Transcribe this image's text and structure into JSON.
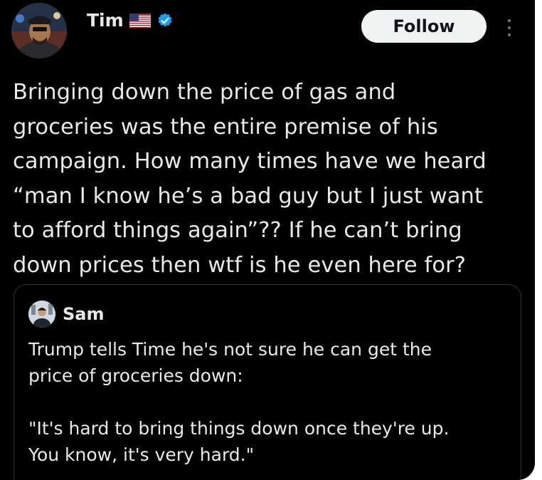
{
  "author": {
    "name": "Tim",
    "flag_icon": "us-flag-icon",
    "verified_icon": "verified-badge-icon",
    "verified_color": "#1d9bf0"
  },
  "actions": {
    "follow_label": "Follow",
    "more_icon": "more-vertical-icon"
  },
  "tweet": {
    "text": "Bringing down the price of gas and\ngroceries was the entire premise of his\ncampaign. How many times have we heard\n“man I know he’s a bad guy but I just want\nto afford things again”?? If he can’t bring\ndown prices then wtf is he even here for?"
  },
  "quoted": {
    "name": "Sam",
    "text": "Trump tells Time he's not sure he can get the\nprice of groceries down:\n\n\"It's hard to bring things down once they're up.\nYou know, it's very hard.\""
  }
}
